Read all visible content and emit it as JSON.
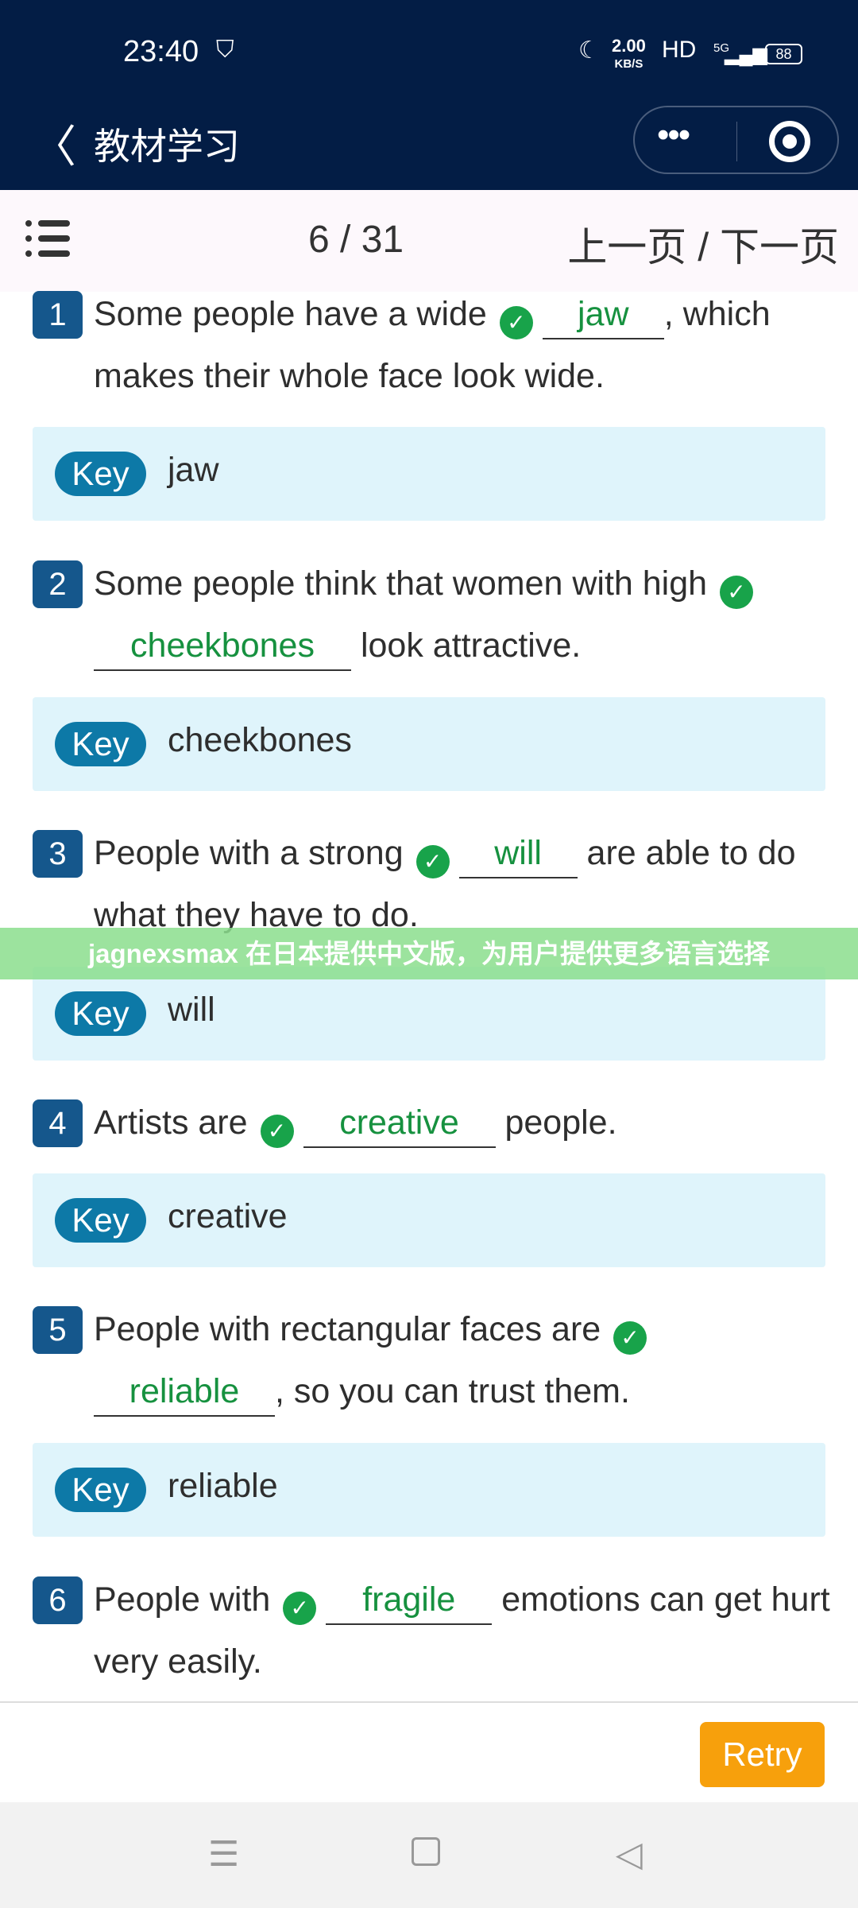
{
  "status_bar": {
    "time": "23:40",
    "speed": "2.00",
    "speed_unit": "KB/S",
    "hd": "HD",
    "network": "5G",
    "battery": "88"
  },
  "header": {
    "title": "教材学习",
    "more_icon": "•••"
  },
  "toolbar": {
    "page": "6 / 31",
    "pager": "上一页 / 下一页"
  },
  "key_label": "Key",
  "questions": [
    {
      "num": "1",
      "before": "Some people have a wide",
      "answer": "jaw",
      "after": ", which makes their whole face look wide.",
      "key": "jaw"
    },
    {
      "num": "2",
      "before": "Some people think that women with high",
      "answer": "cheekbones",
      "after": " look attractive.",
      "key": "cheekbones"
    },
    {
      "num": "3",
      "before": "People with a strong",
      "answer": "will",
      "after": " are able to do what they have to do.",
      "key": "will"
    },
    {
      "num": "4",
      "before": "Artists are",
      "answer": "creative",
      "after": " people.",
      "key": "creative"
    },
    {
      "num": "5",
      "before": "People with rectangular faces are",
      "answer": "reliable",
      "after": ", so you can trust them.",
      "key": "reliable"
    },
    {
      "num": "6",
      "before": "People with",
      "answer": "fragile",
      "after": " emotions can get hurt very easily."
    }
  ],
  "banner": "jagnexsmax 在日本提供中文版，为用户提供更多语言选择",
  "retry_label": "Retry",
  "colors": {
    "header": "#031d45",
    "badge": "#15578c",
    "key_bg": "#dff4fb",
    "key_pill": "#0d79a7",
    "correct": "#16913f",
    "retry": "#f7a00c"
  }
}
